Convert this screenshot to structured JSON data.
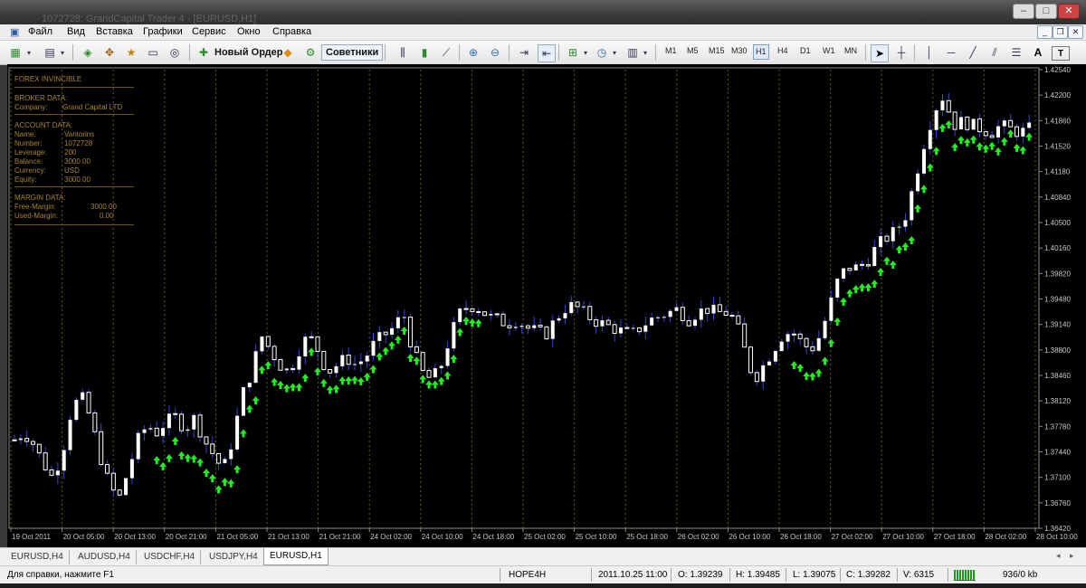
{
  "window": {
    "title": "1072728: GrandCapital Trader 4 - [EURUSD,H1]",
    "minimize": "–",
    "restore": "□",
    "close": "✕",
    "mdi_min": "_",
    "mdi_restore": "❐",
    "mdi_close": "✕"
  },
  "menu": {
    "items": [
      "Файл",
      "Вид",
      "Вставка",
      "Графики",
      "Сервис",
      "Окно",
      "Справка"
    ]
  },
  "toolbar": {
    "new_order_label": "Новый Ордер",
    "advisors_label": "Советники",
    "timeframes": [
      "M1",
      "M5",
      "M15",
      "M30",
      "H1",
      "H4",
      "D1",
      "W1",
      "MN"
    ],
    "active_timeframe": "H1",
    "text_tool": "A",
    "label_tool": "T"
  },
  "info_panel": {
    "title": "FOREX INVINCIBLE",
    "broker_header": "BROKER DATA:",
    "company_label": "Company:",
    "company_value": "Grand Capital LTD",
    "account_header": "ACCOUNT DATA:",
    "name_label": "Name:",
    "name_value": "Vantorins",
    "number_label": "Number:",
    "number_value": "1072728",
    "leverage_label": "Leverage:",
    "leverage_value": "200",
    "balance_label": "Balance:",
    "balance_value": "3000.00",
    "currency_label": "Currency:",
    "currency_value": "USD",
    "equity_label": "Equity:",
    "equity_value": "3000.00",
    "margin_header": "MARGIN DATA:",
    "free_margin_label": "Free-Margin:",
    "free_margin_value": "3000.00",
    "used_margin_label": "Used-Margin:",
    "used_margin_value": "0.00"
  },
  "chart_data": {
    "type": "candlestick",
    "symbol": "EURUSD",
    "timeframe": "H1",
    "ylim": [
      1.3642,
      1.4254
    ],
    "y_ticks": [
      "1.42540",
      "1.42200",
      "1.41860",
      "1.41520",
      "1.41180",
      "1.40840",
      "1.40500",
      "1.40160",
      "1.39820",
      "1.39480",
      "1.39140",
      "1.38800",
      "1.38460",
      "1.38120",
      "1.37780",
      "1.37440",
      "1.37100",
      "1.36760",
      "1.36420"
    ],
    "x_ticks": [
      "19 Oct 2011",
      "20 Oct 05:00",
      "20 Oct 13:00",
      "20 Oct 21:00",
      "21 Oct 05:00",
      "21 Oct 13:00",
      "21 Oct 21:00",
      "24 Oct 02:00",
      "24 Oct 10:00",
      "24 Oct 18:00",
      "25 Oct 02:00",
      "25 Oct 10:00",
      "25 Oct 18:00",
      "26 Oct 02:00",
      "26 Oct 10:00",
      "26 Oct 18:00",
      "27 Oct 02:00",
      "27 Oct 10:00",
      "27 Oct 18:00",
      "28 Oct 02:00",
      "28 Oct 10:00"
    ],
    "candle_color": "#ffffff",
    "wick_color": "#3a44d8",
    "arrow_color": "#22ee22",
    "close_path": [
      1.376,
      1.377,
      1.3755,
      1.373,
      1.371,
      1.374,
      1.38,
      1.382,
      1.379,
      1.374,
      1.37,
      1.368,
      1.372,
      1.376,
      1.378,
      1.377,
      1.3785,
      1.379,
      1.3775,
      1.379,
      1.376,
      1.374,
      1.372,
      1.376,
      1.382,
      1.385,
      1.39,
      1.388,
      1.386,
      1.385,
      1.388,
      1.39,
      1.388,
      1.385,
      1.386,
      1.387,
      1.386,
      1.387,
      1.389,
      1.39,
      1.391,
      1.393,
      1.388,
      1.385,
      1.384,
      1.386,
      1.39,
      1.393,
      1.394,
      1.3935,
      1.3925,
      1.392,
      1.3915,
      1.392,
      1.391,
      1.3905,
      1.39,
      1.392,
      1.3935,
      1.394,
      1.393,
      1.392,
      1.3915,
      1.391,
      1.3905,
      1.39,
      1.391,
      1.392,
      1.3925,
      1.393,
      1.3935,
      1.392,
      1.393,
      1.3935,
      1.393,
      1.393,
      1.392,
      1.388,
      1.384,
      1.386,
      1.388,
      1.39,
      1.3905,
      1.389,
      1.388,
      1.39,
      1.394,
      1.398,
      1.399,
      1.399,
      1.4,
      1.402,
      1.403,
      1.404,
      1.406,
      1.411,
      1.416,
      1.42,
      1.422,
      1.418,
      1.4185,
      1.418,
      1.4175,
      1.417,
      1.418,
      1.4175,
      1.417,
      1.4175
    ]
  },
  "tabs": [
    "EURUSD,H4",
    "AUDUSD,H4",
    "USDCHF,H4",
    "USDJPY,H4",
    "EURUSD,H1"
  ],
  "status": {
    "help_text": "Для справки, нажмите F1",
    "profile": "HOPE4H",
    "datetime": "2011.10.25 11:00",
    "open": "O: 1.39239",
    "high": "H: 1.39485",
    "low": "L: 1.39075",
    "close": "C: 1.39282",
    "volume": "V: 6315",
    "traffic": "936/0 kb"
  }
}
